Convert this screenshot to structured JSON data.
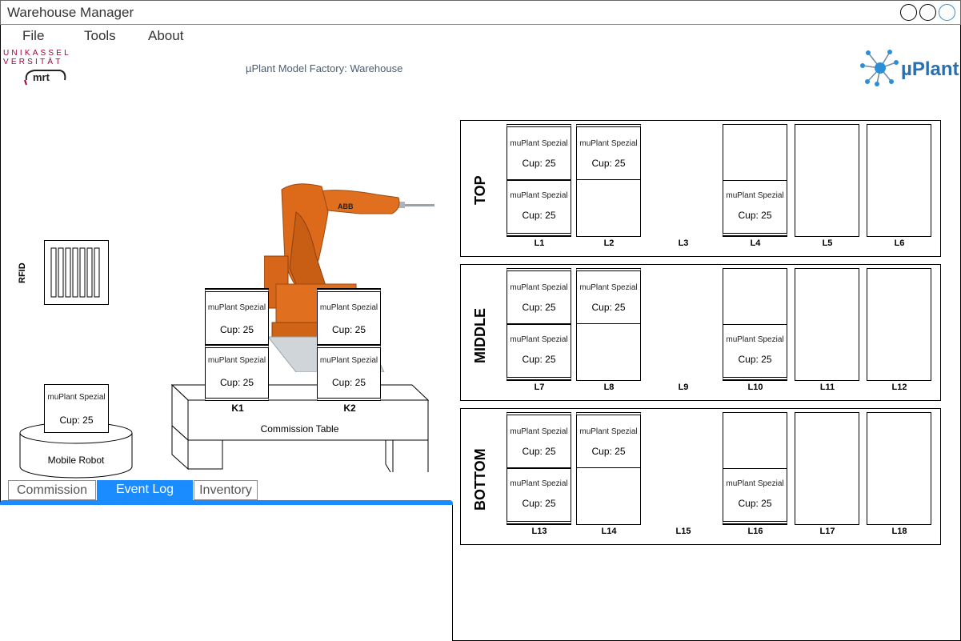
{
  "window": {
    "title": "Warehouse Manager"
  },
  "menu": {
    "file": "File",
    "tools": "Tools",
    "about": "About"
  },
  "logos": {
    "uni": "UNIKASSEL VERSITÄT",
    "mrt": "mrt",
    "uplant": "µPlant"
  },
  "header": {
    "subtitle": "µPlant Model Factory: Warehouse"
  },
  "cup_item": {
    "name": "muPlant Spezial",
    "count": "Cup: 25"
  },
  "rfid": {
    "label": "RFID"
  },
  "robot": {
    "label": "Mobile Robot",
    "brand": "ABB"
  },
  "table": {
    "label": "Commission Table",
    "k1": "K1",
    "k2": "K2"
  },
  "tabs": {
    "commission": "Commission",
    "event_log": "Event Log",
    "inventory": "Inventory",
    "active": "Event Log"
  },
  "shelves": {
    "top": {
      "title": "TOP",
      "slots": [
        "L1",
        "L2",
        "L3",
        "L4",
        "L5",
        "L6"
      ]
    },
    "middle": {
      "title": "MIDDLE",
      "slots": [
        "L7",
        "L8",
        "L9",
        "L10",
        "L11",
        "L12"
      ]
    },
    "bottom": {
      "title": "BOTTOM",
      "slots": [
        "L13",
        "L14",
        "L15",
        "L16",
        "L17",
        "L18"
      ]
    }
  },
  "colors": {
    "tab_active": "#1a8cff",
    "robot_orange": "#e0701f",
    "text_label": "#4a5d70"
  }
}
